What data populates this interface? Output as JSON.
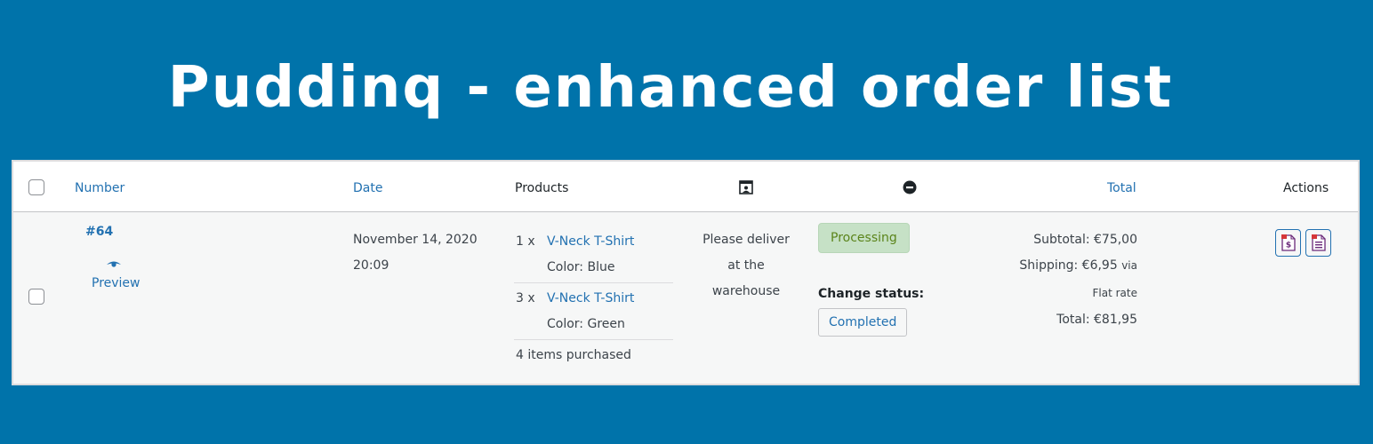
{
  "banner": {
    "title": "Puddinq - enhanced order list"
  },
  "table": {
    "headers": {
      "number": "Number",
      "date": "Date",
      "products": "Products",
      "total": "Total",
      "actions": "Actions"
    },
    "header_icons": {
      "note_icon": "customer-note-icon",
      "status_icon": "status-circle-icon"
    },
    "row": {
      "number": "#64",
      "preview_label": "Preview",
      "date_line1": "November 14, 2020",
      "date_line2": "20:09",
      "products": [
        {
          "qty": "1 x",
          "name": "V-Neck T-Shirt",
          "meta": "Color: Blue"
        },
        {
          "qty": "3 x",
          "name": "V-Neck T-Shirt",
          "meta": "Color: Green"
        }
      ],
      "items_purchased": "4 items purchased",
      "note_lines": [
        "Please deliver",
        "at the",
        "warehouse"
      ],
      "status": "Processing",
      "change_status_label": "Change status:",
      "change_status_button": "Completed",
      "subtotal": "Subtotal: €75,00",
      "shipping": "Shipping: €6,95",
      "shipping_via": "via",
      "shipping_method": "Flat rate",
      "total": "Total: €81,95",
      "actions": [
        "pdf-invoice-icon",
        "pdf-packing-slip-icon"
      ]
    }
  },
  "colors": {
    "background": "#0073aa",
    "link": "#2271b1",
    "processing_bg": "#c6e1c6",
    "processing_text": "#5b841b",
    "action_icon_accent": "#d63638"
  }
}
